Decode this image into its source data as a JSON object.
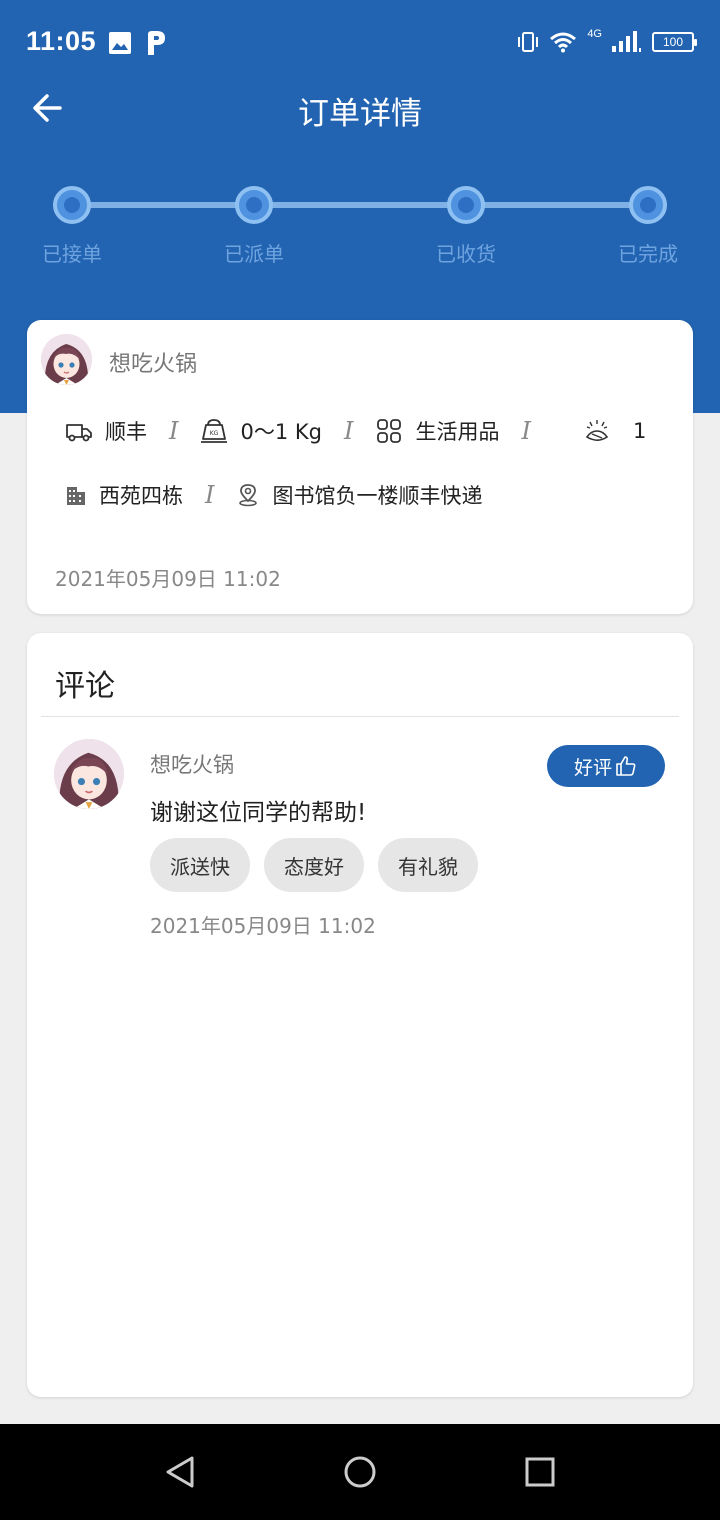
{
  "status_bar": {
    "time": "11:05",
    "network": "4G",
    "battery": "100",
    "icons": [
      "gallery-icon",
      "parking-app-icon",
      "vibrate-icon",
      "wifi-icon",
      "signal-icon",
      "battery-icon"
    ]
  },
  "header": {
    "title": "订单详情",
    "back_icon": "arrow-left-icon"
  },
  "progress": {
    "steps": [
      {
        "label": "已接单"
      },
      {
        "label": "已派单"
      },
      {
        "label": "已收货"
      },
      {
        "label": "已完成"
      }
    ],
    "colors": {
      "line": "#7fb0e6",
      "dot": "#4f93e0",
      "label": "#6fa3e0"
    }
  },
  "order": {
    "user_name": "想吃火锅",
    "courier": "顺丰",
    "weight": "0〜1 Kg",
    "category": "生活用品",
    "quantity": "1",
    "separator": "I",
    "building": "西苑四栋",
    "location": "图书馆负一楼顺丰快递",
    "time": "2021年05月09日 11:02"
  },
  "comment": {
    "section_title": "评论",
    "user_name": "想吃火锅",
    "badge_label": "好评",
    "text": "谢谢这位同学的帮助!",
    "tags": [
      "派送快",
      "态度好",
      "有礼貌"
    ],
    "time": "2021年05月09日 11:02"
  },
  "nav": {
    "buttons": [
      "back-triangle-icon",
      "home-circle-icon",
      "recents-square-icon"
    ]
  },
  "colors": {
    "primary": "#2264b1",
    "background": "#efefef",
    "card": "#ffffff"
  }
}
